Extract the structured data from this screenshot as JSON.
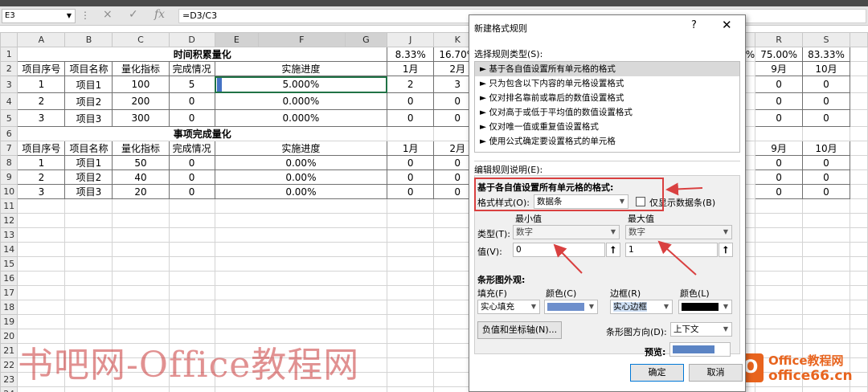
{
  "formula_bar": {
    "name_box": "E3",
    "formula": "=D3/C3",
    "cancel_glyph": "×",
    "enter_glyph": "✓",
    "fx_glyph": "fx"
  },
  "sheet": {
    "columns": [
      "A",
      "B",
      "C",
      "D",
      "E",
      "F",
      "G",
      "J",
      "K",
      "R",
      "S"
    ],
    "rows": [
      {
        "n": "1",
        "title": "时间积累量化",
        "j": "8.33%",
        "k": "16.70%",
        "r": "75.00%",
        "s": "83.33%"
      },
      {
        "n": "2",
        "a": "项目序号",
        "b": "项目名称",
        "c": "量化指标",
        "d": "完成情况",
        "ef": "实施进度",
        "j": "1月",
        "k": "2月",
        "r": "9月",
        "s": "10月"
      },
      {
        "n": "3",
        "a": "1",
        "b": "项目1",
        "c": "100",
        "d": "5",
        "ef": "5.000%",
        "j": "2",
        "k": "3",
        "r": "0",
        "s": "0"
      },
      {
        "n": "4",
        "a": "2",
        "b": "项目2",
        "c": "200",
        "d": "0",
        "ef": "0.000%",
        "j": "0",
        "k": "0",
        "r": "0",
        "s": "0"
      },
      {
        "n": "5",
        "a": "3",
        "b": "项目3",
        "c": "300",
        "d": "0",
        "ef": "0.000%",
        "j": "0",
        "k": "0",
        "r": "0",
        "s": "0"
      },
      {
        "n": "6",
        "title": "事项完成量化"
      },
      {
        "n": "7",
        "a": "项目序号",
        "b": "项目名称",
        "c": "量化指标",
        "d": "完成情况",
        "ef": "实施进度",
        "j": "1月",
        "k": "2月",
        "r": "9月",
        "s": "10月"
      },
      {
        "n": "8",
        "a": "1",
        "b": "项目1",
        "c": "50",
        "d": "0",
        "ef": "0.00%",
        "j": "0",
        "k": "0",
        "r": "0",
        "s": "0"
      },
      {
        "n": "9",
        "a": "2",
        "b": "项目2",
        "c": "40",
        "d": "0",
        "ef": "0.00%",
        "j": "0",
        "k": "0",
        "r": "0",
        "s": "0"
      },
      {
        "n": "10",
        "a": "3",
        "b": "项目3",
        "c": "20",
        "d": "0",
        "ef": "0.00%",
        "j": "0",
        "k": "0",
        "r": "0",
        "s": "0"
      },
      {
        "n": "11"
      },
      {
        "n": "12"
      },
      {
        "n": "13"
      },
      {
        "n": "14"
      },
      {
        "n": "15"
      },
      {
        "n": "16"
      },
      {
        "n": "17"
      },
      {
        "n": "18"
      },
      {
        "n": "19"
      },
      {
        "n": "20"
      },
      {
        "n": "21"
      },
      {
        "n": "22"
      },
      {
        "n": "23"
      },
      {
        "n": "24"
      }
    ],
    "partial_col_value": "%",
    "data_bar_color": "#4472c4"
  },
  "dialog": {
    "title": "新建格式规则",
    "help": "?",
    "close": "✕",
    "rule_type_label": "选择规则类型(S):",
    "rule_types": [
      "► 基于各自值设置所有单元格的格式",
      "► 只为包含以下内容的单元格设置格式",
      "► 仅对排名靠前或靠后的数值设置格式",
      "► 仅对高于或低于平均值的数值设置格式",
      "► 仅对唯一值或重复值设置格式",
      "► 使用公式确定要设置格式的单元格"
    ],
    "edit_label": "编辑规则说明(E):",
    "edit_header": "基于各自值设置所有单元格的格式:",
    "format_style_label": "格式样式(O):",
    "format_style_value": "数据条",
    "show_bar_only_label": "仅显示数据条(B)",
    "min_label": "最小值",
    "max_label": "最大值",
    "type_label": "类型(T):",
    "min_type": "数字",
    "max_type": "数字",
    "value_label": "值(V):",
    "min_value": "0",
    "max_value": "1",
    "bar_appearance_label": "条形图外观:",
    "fill_label": "填充(F)",
    "fill_color_label": "颜色(C)",
    "border_label": "边框(R)",
    "border_color_label": "颜色(L)",
    "fill_value": "实心填充",
    "border_value": "实心边框",
    "fill_color": "#6e8fcc",
    "border_color": "#000000",
    "neg_axis_button": "负值和坐标轴(N)...",
    "direction_label": "条形图方向(D):",
    "direction_value": "上下文",
    "preview_label": "预览:",
    "ok": "确定",
    "cancel": "取消"
  },
  "watermark": "书吧网-Office教程网",
  "logo": {
    "icon": "O",
    "line1": "Office教程网",
    "line2": "office66.cn"
  },
  "colors": {
    "accent_red": "#d94040",
    "excel_green": "#217346"
  }
}
